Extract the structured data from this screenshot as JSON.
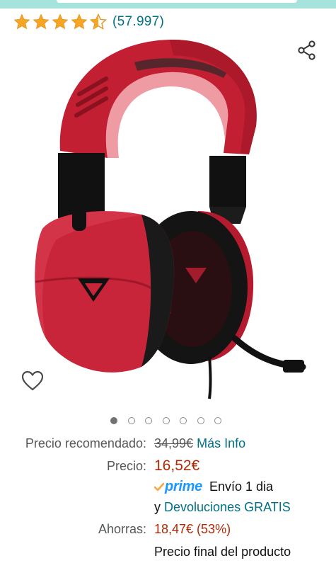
{
  "rating": {
    "stars_value": 4.5,
    "stars_max": 5,
    "count_label": "(57.997)",
    "star_color": "#f5a623"
  },
  "icons": {
    "share": "share-icon",
    "wishlist": "heart-outline-icon"
  },
  "product_image": {
    "alt": "product-photo",
    "primary_color": "#c8243a"
  },
  "carousel": {
    "total": 7,
    "active_index": 0
  },
  "pricing": {
    "list_price_label": "Precio recomendado:",
    "list_price_value": "34,99€",
    "more_info_link": "Más Info",
    "price_label": "Precio:",
    "price_value": "16,52€",
    "prime_brand": "prime",
    "prime_shipping": "Envío 1 dia",
    "returns_prefix": "y",
    "returns_link": "Devoluciones GRATIS",
    "savings_label": "Ahorras:",
    "savings_value": "18,47€ (53%)",
    "final_price_note": "Precio final del producto"
  },
  "colors": {
    "link": "#007185",
    "price": "#b12704",
    "prime": "#1a98ff",
    "muted": "#565959"
  }
}
